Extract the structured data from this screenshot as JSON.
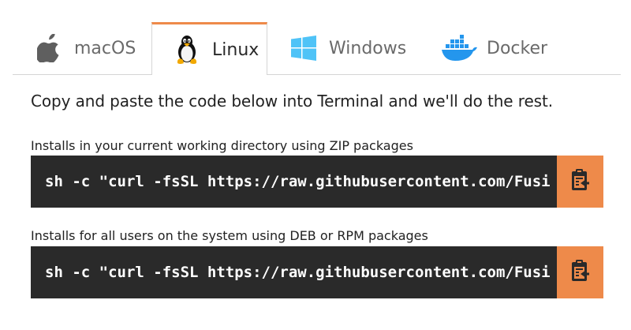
{
  "tabs": [
    {
      "label": "macOS",
      "icon": "apple-icon",
      "active": false
    },
    {
      "label": "Linux",
      "icon": "tux-penguin-icon",
      "active": true
    },
    {
      "label": "Windows",
      "icon": "windows-logo-icon",
      "active": false
    },
    {
      "label": "Docker",
      "icon": "docker-whale-icon",
      "active": false
    }
  ],
  "intro": "Copy and paste the code below into Terminal and we'll do the rest.",
  "installs": [
    {
      "caption": "Installs in your current working directory using ZIP packages",
      "command": "sh -c \"curl -fsSL https://raw.githubusercontent.com/Fusi",
      "copy_icon": "clipboard-copy-icon"
    },
    {
      "caption": "Installs for all users on the system using DEB or RPM packages",
      "command": "sh -c \"curl -fsSL https://raw.githubusercontent.com/Fusi",
      "copy_icon": "clipboard-copy-icon"
    }
  ],
  "colors": {
    "accent": "#ee8a4a",
    "code_bg": "#2a2a2a",
    "windows_blue": "#4fc3f7",
    "docker_blue": "#2496ed"
  }
}
